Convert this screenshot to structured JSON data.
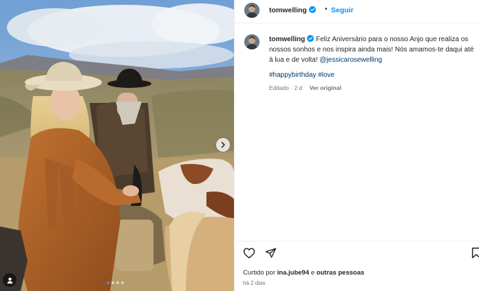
{
  "post": {
    "username": "tomwelling",
    "header_separator": "•",
    "follow_label": "Seguir",
    "caption_username": "tomwelling",
    "caption_text": "Feliz Aniversário para o nosso Anjo que realiza os nossos sonhos e nos inspira ainda mais! Nós amamos-te daqui até à lua e de volta!",
    "caption_mention": "@jessicarosewelling",
    "hashtags": [
      "#happybirthday",
      "#love"
    ],
    "edited_label": "Editado",
    "edited_separator": "·",
    "edited_time": "2 d",
    "see_original_label": "Ver original",
    "likes_prefix": "Curtido por",
    "likes_user": "ina.jube94",
    "likes_connector": "e",
    "likes_others": "outras pessoas",
    "date_label": "há 2 dias"
  },
  "carousel": {
    "total": 4,
    "active_index": 0
  },
  "icons": {
    "verified": "verified-badge-icon",
    "like": "heart-icon",
    "share": "paper-plane-icon",
    "save": "bookmark-icon",
    "next": "chevron-right-icon",
    "tags": "user-tag-icon"
  },
  "colors": {
    "link_blue": "#0095f6",
    "link_dark": "#00376b",
    "verified": "#0095f6",
    "muted_text": "#737373"
  }
}
